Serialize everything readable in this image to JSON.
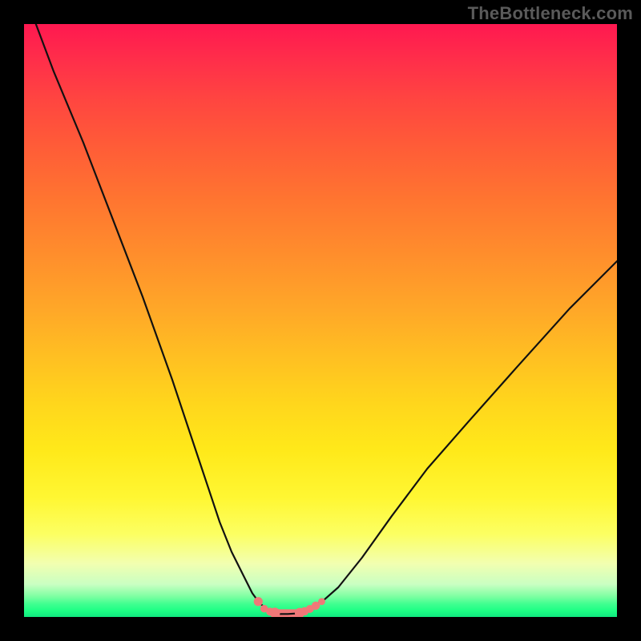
{
  "attribution": "TheBottleneck.com",
  "chart_data": {
    "type": "line",
    "title": "",
    "xlabel": "",
    "ylabel": "",
    "xlim": [
      0,
      100
    ],
    "ylim": [
      0,
      100
    ],
    "grid": false,
    "legend": false,
    "background": "rainbow-risk-gradient",
    "series": [
      {
        "name": "bottleneck-curve",
        "x": [
          2,
          5,
          10,
          15,
          20,
          25,
          28,
          31,
          33,
          35,
          37,
          38.5,
          39.6,
          41,
          42,
          43,
          44.5,
          46,
          47,
          48,
          50.5,
          53,
          57,
          62,
          68,
          75,
          83,
          92,
          100
        ],
        "y": [
          100,
          92,
          80,
          67,
          54,
          40,
          31,
          22,
          16,
          11,
          7,
          4,
          2.5,
          1.2,
          0.7,
          0.5,
          0.5,
          0.6,
          0.9,
          1.4,
          2.8,
          5,
          10,
          17,
          25,
          33,
          42,
          52,
          60
        ],
        "stroke": "#111111",
        "stroke_width": 2
      }
    ],
    "markers": [
      {
        "name": "valley-marker-left",
        "type": "scatter",
        "x": [
          39.5,
          40.5,
          41.5,
          42.3
        ],
        "y": [
          2.6,
          1.4,
          0.9,
          0.7
        ],
        "r": [
          5.6,
          4.8,
          5.0,
          6.5
        ],
        "color": "#f07878"
      },
      {
        "name": "valley-marker-right",
        "type": "scatter",
        "x": [
          46.5,
          47.3,
          48.2,
          49.2,
          50.2
        ],
        "y": [
          0.7,
          0.95,
          1.35,
          1.9,
          2.6
        ],
        "r": [
          6.2,
          5.2,
          5.0,
          5.2,
          4.4
        ],
        "color": "#f07878"
      }
    ],
    "valley_band": {
      "x0": 42.3,
      "x1": 46.5,
      "y": 0.55,
      "color": "#f07878",
      "thickness": 11
    },
    "gradient_stops": [
      {
        "offset": 0.0,
        "color": "#ff1850"
      },
      {
        "offset": 0.5,
        "color": "#ffb326"
      },
      {
        "offset": 0.8,
        "color": "#fff733"
      },
      {
        "offset": 0.95,
        "color": "#c9ffc2"
      },
      {
        "offset": 1.0,
        "color": "#11e880"
      }
    ]
  }
}
